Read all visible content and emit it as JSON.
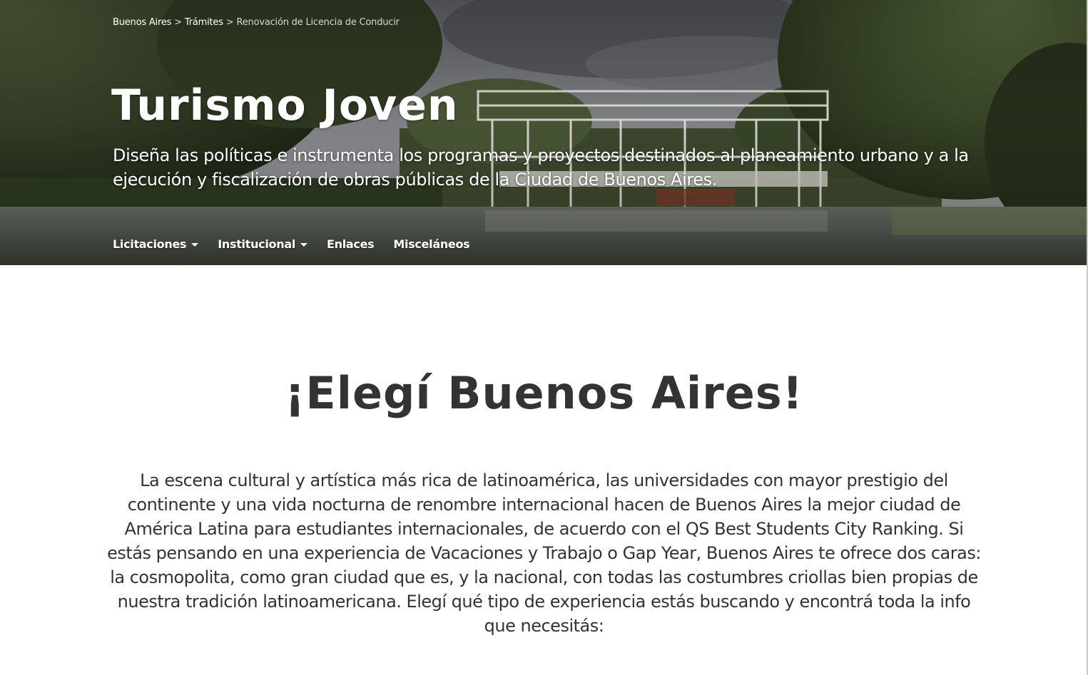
{
  "breadcrumb": {
    "items": [
      "Buenos Aires",
      "Trámites"
    ],
    "separator": ">",
    "current": "Renovación de Licencia de Conducir"
  },
  "hero": {
    "title": "Turismo Joven",
    "description": "Diseña las políticas e instrumenta los programas y proyectos destinados al planeamiento urbano y a la ejecución y fiscalización de obras públicas de la Ciudad de Buenos Aires."
  },
  "nav": {
    "items": [
      {
        "label": "Licitaciones",
        "has_dropdown": true
      },
      {
        "label": "Institucional",
        "has_dropdown": true
      },
      {
        "label": "Enlaces",
        "has_dropdown": false
      },
      {
        "label": "Misceláneos",
        "has_dropdown": false
      }
    ]
  },
  "main": {
    "heading": "¡Elegí Buenos Aires!",
    "intro": "La escena cultural y artística más rica de latinoamérica, las universidades con mayor prestigio del continente y una vida nocturna de renombre internacional hacen de Buenos Aires la mejor ciudad de América Latina para estudiantes internacionales, de acuerdo con el QS Best Students City Ranking. Si estás pensando en una experiencia de Vacaciones y Trabajo o Gap Year, Buenos Aires te ofrece dos caras: la cosmopolita, como gran ciudad que es, y la nacional, con todas las costumbres criollas bien propias de nuestra tradición latinoamericana. Elegí qué tipo de experiencia estás buscando y encontrá toda la info que necesitás:"
  },
  "colors": {
    "hero_text": "#ffffff",
    "body_text": "#333333",
    "background": "#ffffff"
  }
}
